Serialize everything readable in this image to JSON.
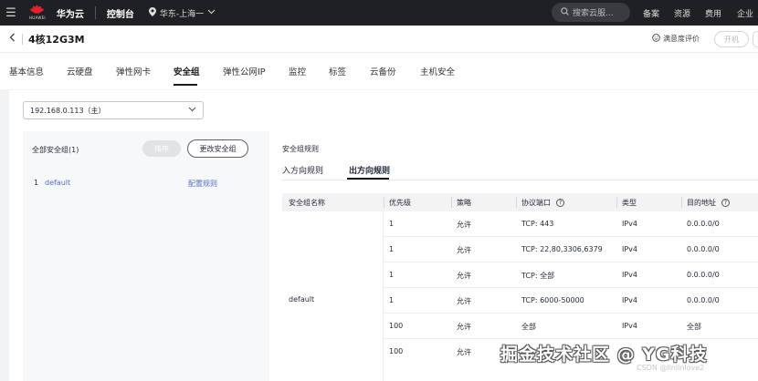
{
  "topbar": {
    "logo_text": "HUAWEI",
    "brand": "华为云",
    "console": "控制台",
    "region": "华东-上海一",
    "search_placeholder": "搜索云服...",
    "nav": [
      "备案",
      "资源",
      "费用",
      "企业"
    ]
  },
  "header": {
    "title": "4核12G3M",
    "rating": "满意度评价",
    "power_on": "开机"
  },
  "tabs": [
    "基本信息",
    "云硬盘",
    "弹性网卡",
    "安全组",
    "弹性公网IP",
    "监控",
    "标签",
    "云备份",
    "主机安全"
  ],
  "active_tab": "安全组",
  "nic_select": {
    "value": "192.168.0.113（主）"
  },
  "left_panel": {
    "all_groups": "全部安全组(1)",
    "sort_button": "排序",
    "change_button": "更改安全组",
    "rows": [
      {
        "index": "1",
        "name": "default",
        "action": "配置规则"
      }
    ]
  },
  "rules": {
    "title": "安全组规则",
    "subtabs": [
      "入方向规则",
      "出方向规则"
    ],
    "active_subtab": "出方向规则",
    "columns": [
      "安全组名称",
      "优先级",
      "策略",
      "协议端口",
      "类型",
      "目的地址"
    ],
    "group_name": "default",
    "rows": [
      {
        "priority": "1",
        "action": "允许",
        "port": "TCP: 443",
        "type": "IPv4",
        "dest": "0.0.0.0/0"
      },
      {
        "priority": "1",
        "action": "允许",
        "port": "TCP: 22,80,3306,6379",
        "type": "IPv4",
        "dest": "0.0.0.0/0"
      },
      {
        "priority": "1",
        "action": "允许",
        "port": "TCP: 全部",
        "type": "IPv4",
        "dest": "0.0.0.0/0"
      },
      {
        "priority": "1",
        "action": "允许",
        "port": "TCP: 6000-50000",
        "type": "IPv4",
        "dest": "0.0.0.0/0"
      },
      {
        "priority": "100",
        "action": "允许",
        "port": "全部",
        "type": "IPv4",
        "dest": "全部"
      },
      {
        "priority": "100",
        "action": "允许",
        "port": "",
        "type": "",
        "dest": ""
      }
    ]
  },
  "watermark": {
    "main": "掘金技术社区 @ YG科技",
    "csdn": "CSDN @linlinlove2"
  },
  "colors": {
    "topbar_bg": "#1f2024",
    "link": "#526ecc",
    "logo_red": "#e62129"
  }
}
